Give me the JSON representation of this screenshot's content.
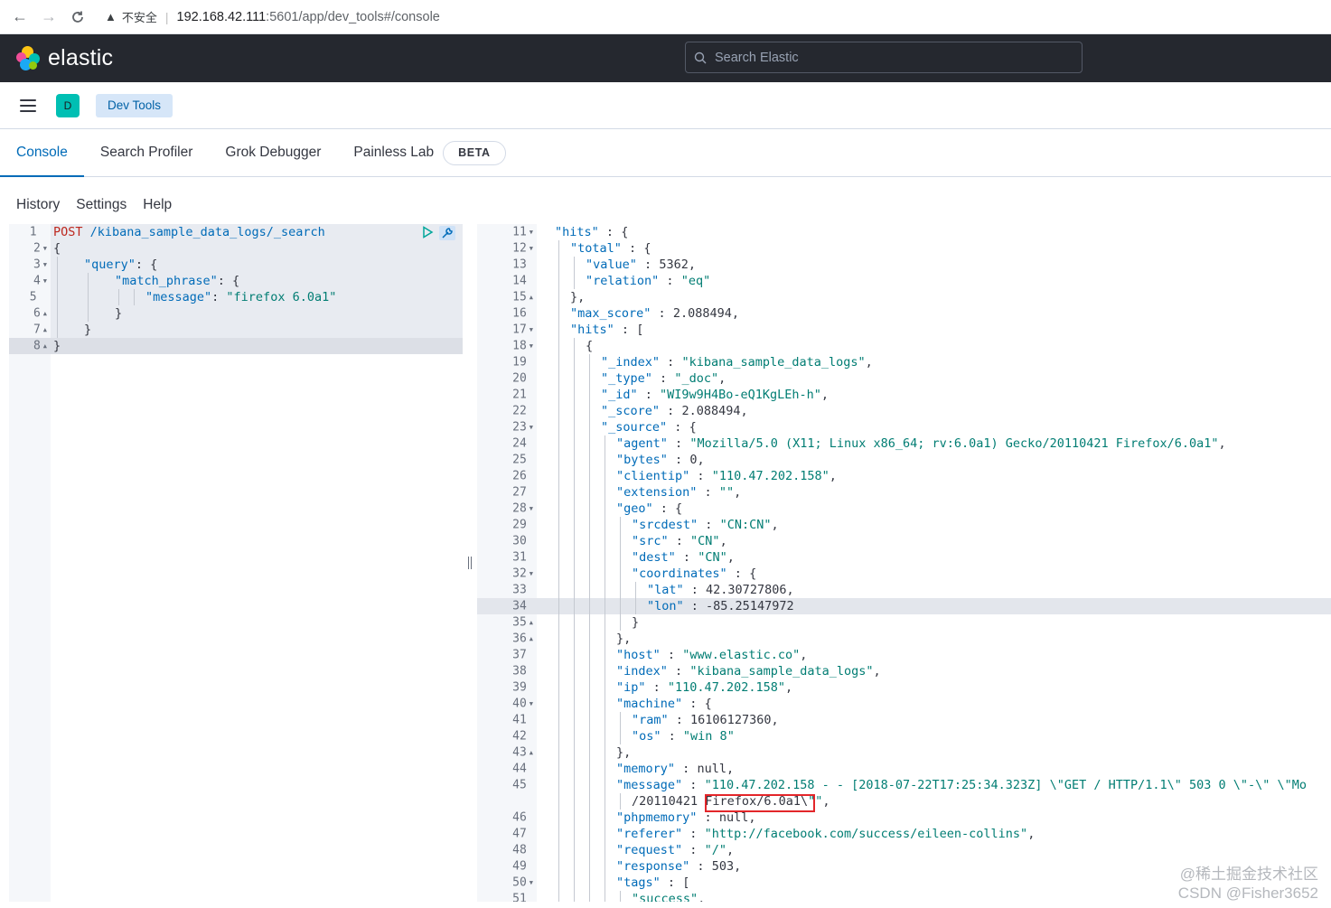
{
  "browser": {
    "security_label": "不安全",
    "url_host": "192.168.42.111",
    "url_rest": ":5601/app/dev_tools#/console"
  },
  "header": {
    "brand": "elastic",
    "search_placeholder": "Search Elastic",
    "colors": {
      "background": "#25282f",
      "teal": "#00bfb3"
    }
  },
  "subheader": {
    "space_initial": "D",
    "breadcrumb": "Dev Tools"
  },
  "tabs": [
    {
      "label": "Console",
      "active": true
    },
    {
      "label": "Search Profiler",
      "active": false
    },
    {
      "label": "Grok Debugger",
      "active": false
    },
    {
      "label": "Painless Lab",
      "active": false
    }
  ],
  "beta_badge": "BETA",
  "console_menu": [
    "History",
    "Settings",
    "Help"
  ],
  "request": {
    "method": "POST",
    "path": "/kibana_sample_data_logs/_search",
    "lines": [
      {
        "n": "1",
        "fold": ""
      },
      {
        "n": "2",
        "fold": "down"
      },
      {
        "n": "3",
        "fold": "down"
      },
      {
        "n": "4",
        "fold": "down"
      },
      {
        "n": "5",
        "fold": ""
      },
      {
        "n": "6",
        "fold": "up"
      },
      {
        "n": "7",
        "fold": "up"
      },
      {
        "n": "8",
        "fold": "up"
      }
    ],
    "query_key": "\"query\"",
    "match_key": "\"match_phrase\"",
    "message_key": "\"message\"",
    "message_value": "\"firefox 6.0a1\""
  },
  "response": {
    "line_numbers": [
      "11",
      "12",
      "13",
      "14",
      "15",
      "16",
      "17",
      "18",
      "19",
      "20",
      "21",
      "22",
      "23",
      "24",
      "25",
      "26",
      "27",
      "28",
      "29",
      "30",
      "31",
      "32",
      "33",
      "34",
      "35",
      "36",
      "37",
      "38",
      "39",
      "40",
      "41",
      "42",
      "43",
      "44",
      "45",
      "",
      "46",
      "47",
      "48",
      "49",
      "50",
      "51"
    ],
    "folds": [
      "down",
      "down",
      "",
      "",
      "up",
      "",
      "down",
      "down",
      "",
      "",
      "",
      "",
      "down",
      "",
      "",
      "",
      "",
      "down",
      "",
      "",
      "",
      "down",
      "",
      "",
      "up",
      "up",
      "",
      "",
      "",
      "down",
      "",
      "",
      "up",
      "",
      "",
      "",
      "",
      "",
      "",
      "",
      "down",
      ""
    ],
    "lines": [
      "\"hits\" : {",
      "\"total\" : {",
      "\"value\" : 5362,",
      "\"relation\" : \"eq\"",
      "},",
      "\"max_score\" : 2.088494,",
      "\"hits\" : [",
      "{",
      "\"_index\" : \"kibana_sample_data_logs\",",
      "\"_type\" : \"_doc\",",
      "\"_id\" : \"WI9w9H4Bo-eQ1KgLEh-h\",",
      "\"_score\" : 2.088494,",
      "\"_source\" : {",
      "\"agent\" : \"Mozilla/5.0 (X11; Linux x86_64; rv:6.0a1) Gecko/20110421 Firefox/6.0a1\",",
      "\"bytes\" : 0,",
      "\"clientip\" : \"110.47.202.158\",",
      "\"extension\" : \"\",",
      "\"geo\" : {",
      "\"srcdest\" : \"CN:CN\",",
      "\"src\" : \"CN\",",
      "\"dest\" : \"CN\",",
      "\"coordinates\" : {",
      "\"lat\" : 42.30727806,",
      "\"lon\" : -85.25147972",
      "}",
      "},",
      "\"host\" : \"www.elastic.co\",",
      "\"index\" : \"kibana_sample_data_logs\",",
      "\"ip\" : \"110.47.202.158\",",
      "\"machine\" : {",
      "\"ram\" : 16106127360,",
      "\"os\" : \"win 8\"",
      "},",
      "\"memory\" : null,",
      "\"message\" : \"110.47.202.158 - - [2018-07-22T17:25:34.323Z] \\\"GET / HTTP/1.1\\\" 503 0 \\\"-\\\" \\\"Mo",
      "/20110421 Firefox/6.0a1\\\"\",",
      "\"phpmemory\" : null,",
      "\"referer\" : \"http://facebook.com/success/eileen-collins\",",
      "\"request\" : \"/\",",
      "\"response\" : 503,",
      "\"tags\" : [",
      "\"success\","
    ]
  },
  "watermark": {
    "line1": "@稀土掘金技术社区",
    "line2": "CSDN @Fisher3652"
  }
}
